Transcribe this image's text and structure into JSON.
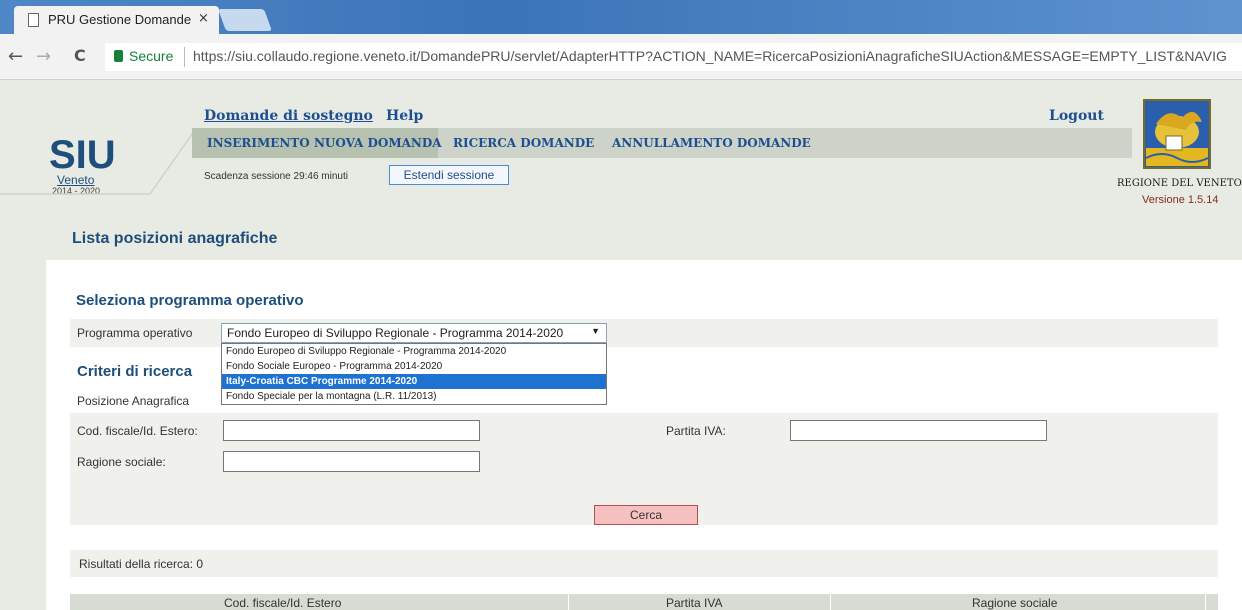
{
  "browser": {
    "tab_title": "PRU Gestione Domande",
    "tab_close": "×",
    "secure_label": "Secure",
    "url": "https://siu.collaudo.regione.veneto.it/DomandePRU/servlet/AdapterHTTP?ACTION_NAME=RicercaPosizioniAnagraficheSIUAction&MESSAGE=EMPTY_LIST&NAVIG",
    "back": "←",
    "forward": "→",
    "reload": "C"
  },
  "brand": {
    "siu": "SIU",
    "veneto": "Veneto",
    "years": "2014 - 2020"
  },
  "header": {
    "main_link": "Domande di sostegno",
    "help": "Help",
    "logout": "Logout",
    "menu": [
      "INSERIMENTO NUOVA DOMANDA",
      "RICERCA DOMANDE",
      "ANNULLAMENTO DOMANDE"
    ],
    "session_text": "Scadenza sessione 29:46 minuti",
    "extend_button": "Estendi sessione",
    "regione": "REGIONE DEL VENETO",
    "versione": "Versione 1.5.14"
  },
  "page_title": "Lista posizioni anagrafiche",
  "programma": {
    "section_title": "Seleziona programma operativo",
    "label": "Programma operativo",
    "selected": "Fondo Europeo di Sviluppo Regionale - Programma 2014-2020",
    "options": [
      "Fondo Europeo di Sviluppo Regionale - Programma 2014-2020",
      "Fondo Sociale Europeo - Programma 2014-2020",
      "Italy-Croatia CBC Programme 2014-2020",
      "Fondo Speciale per la montagna (L.R. 11/2013)"
    ],
    "highlighted_index": 2
  },
  "criteri": {
    "section_title": "Criteri di ricerca",
    "subsection": "Posizione Anagrafica",
    "cod_fiscale_label": "Cod. fiscale/Id. Estero:",
    "cod_fiscale_value": "",
    "partita_iva_label": "Partita IVA:",
    "partita_iva_value": "",
    "ragione_sociale_label": "Ragione sociale:",
    "ragione_sociale_value": "",
    "search_button": "Cerca"
  },
  "results": {
    "label": "Risultati della ricerca: 0",
    "columns": [
      "Cod. fiscale/Id. Estero",
      "Partita IVA",
      "Ragione sociale"
    ]
  },
  "colors": {
    "accent": "#1d4e8f",
    "highlight": "#1e73d0",
    "search_button": "#f6c0c0"
  }
}
